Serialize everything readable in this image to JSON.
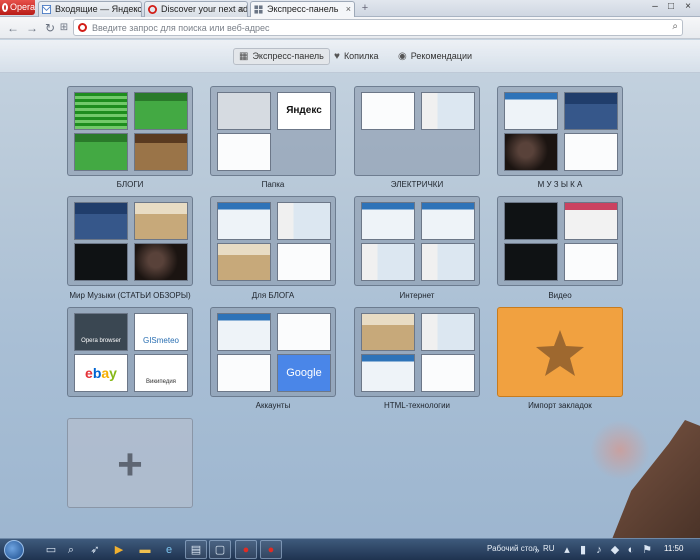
{
  "browser": {
    "menu_label": "Opera",
    "tabs": [
      {
        "title": "Входящие — Яндекс.Почта",
        "favicon": "mail-icon"
      },
      {
        "title": "Discover your next adventure",
        "favicon": "opera-icon"
      },
      {
        "title": "Экспресс-панель",
        "favicon": "speed-dial-icon",
        "active": true
      }
    ],
    "new_tab_label": "+",
    "address": {
      "placeholder": "Введите запрос для поиска или веб-адрес",
      "value": ""
    }
  },
  "speed_dial_toolbar": {
    "tabs": [
      {
        "label": "Экспресс-панель",
        "icon": "grid-icon"
      },
      {
        "label": "Копилка",
        "icon": "heart-icon"
      },
      {
        "label": "Рекомендации",
        "icon": "eye-icon"
      }
    ]
  },
  "tiles": [
    {
      "label": "БЛОГИ"
    },
    {
      "label": "Папка",
      "thumb_text": {
        "yandex": "Яндекс"
      }
    },
    {
      "label": "ЭЛЕКТРИЧКИ"
    },
    {
      "label": "М У З Ы К А"
    },
    {
      "label": "Мир Музыки (СТАТЬИ ОБЗОРЫ)"
    },
    {
      "label": "Для БЛОГА"
    },
    {
      "label": "Интернет"
    },
    {
      "label": "Видео"
    },
    {
      "label": "",
      "thumb_text": {
        "opera": "Opera browser",
        "gismeteo": "GISmeteo",
        "ebay": "ebay",
        "wiki": "Википедия"
      }
    },
    {
      "label": "Аккаунты",
      "thumb_text": {
        "google": "Google"
      }
    },
    {
      "label": "HTML-технологии"
    },
    {
      "label": "Импорт закладок"
    }
  ],
  "add_tile": {
    "label": "+"
  },
  "taskbar": {
    "desktop_label": "Рабочий стол",
    "language": "RU",
    "clock": "11:50"
  },
  "colors": {
    "opera_red": "#d21d17",
    "import_tile": "#f1a140",
    "taskbar": "#1f3350"
  }
}
